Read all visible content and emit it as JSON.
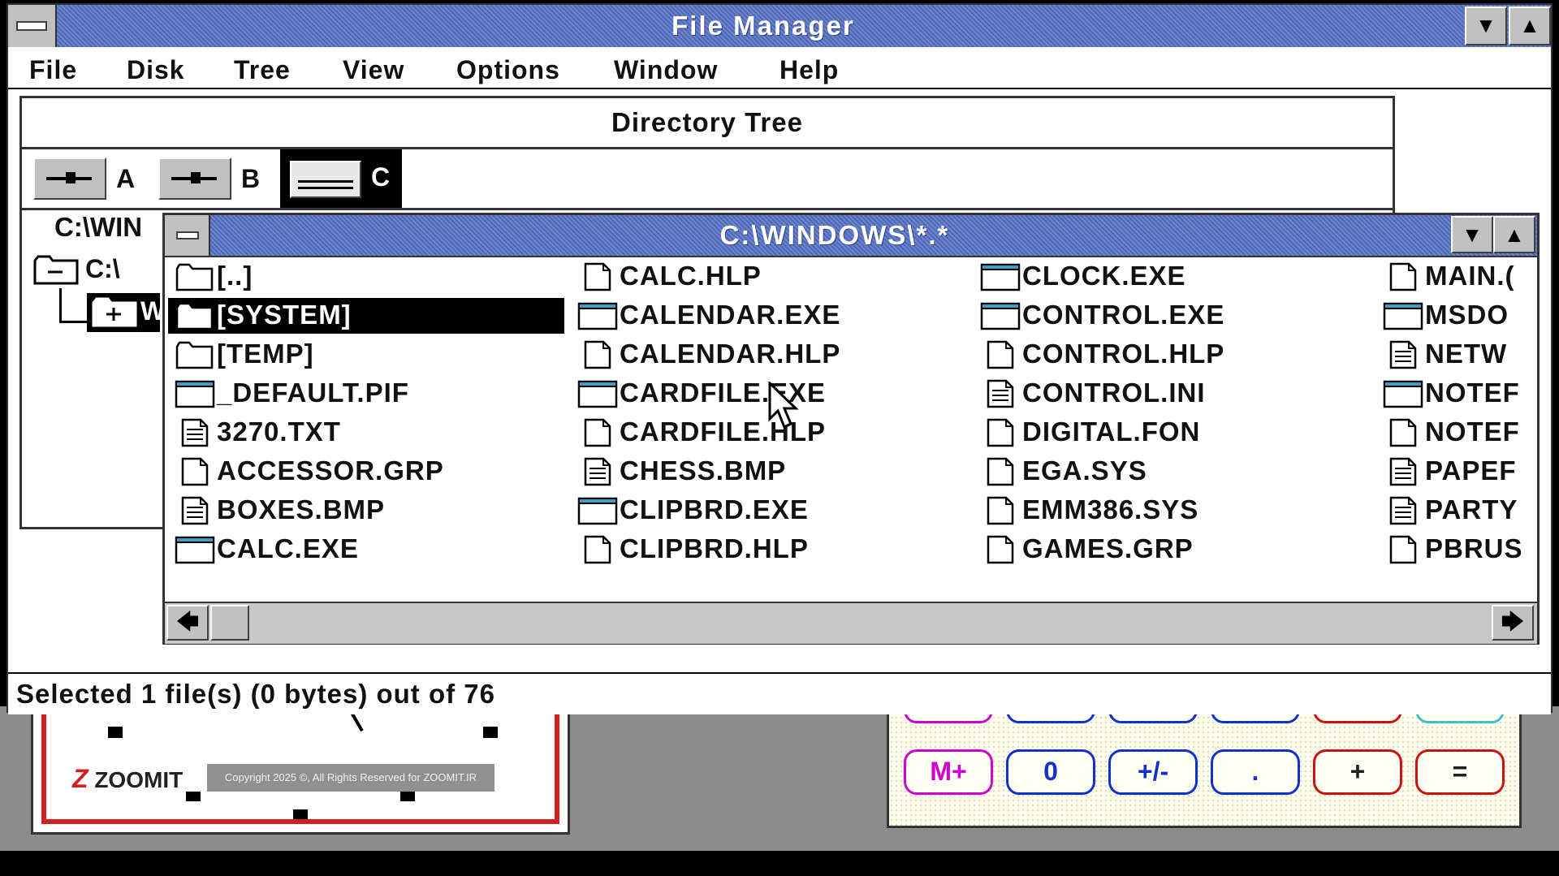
{
  "main_window": {
    "title": "File Manager",
    "menu": [
      "File",
      "Disk",
      "Tree",
      "View",
      "Options",
      "Window",
      "Help"
    ]
  },
  "tree_window": {
    "title": "Directory Tree",
    "drives": [
      "A",
      "B",
      "C"
    ],
    "selected_drive": "C",
    "path": "C:\\WIN",
    "nodes": [
      "C:\\",
      "W"
    ]
  },
  "dir_window": {
    "title": "C:\\WINDOWS\\*.*",
    "columns": [
      [
        {
          "name": "[..]",
          "type": "folder"
        },
        {
          "name": "[SYSTEM]",
          "type": "folder",
          "selected": true
        },
        {
          "name": "[TEMP]",
          "type": "folder"
        },
        {
          "name": "_DEFAULT.PIF",
          "type": "exe"
        },
        {
          "name": "3270.TXT",
          "type": "doc"
        },
        {
          "name": "ACCESSOR.GRP",
          "type": "file"
        },
        {
          "name": "BOXES.BMP",
          "type": "doc"
        },
        {
          "name": "CALC.EXE",
          "type": "exe"
        }
      ],
      [
        {
          "name": "CALC.HLP",
          "type": "file"
        },
        {
          "name": "CALENDAR.EXE",
          "type": "exe"
        },
        {
          "name": "CALENDAR.HLP",
          "type": "file"
        },
        {
          "name": "CARDFILE.EXE",
          "type": "exe"
        },
        {
          "name": "CARDFILE.HLP",
          "type": "file"
        },
        {
          "name": "CHESS.BMP",
          "type": "doc"
        },
        {
          "name": "CLIPBRD.EXE",
          "type": "exe"
        },
        {
          "name": "CLIPBRD.HLP",
          "type": "file"
        }
      ],
      [
        {
          "name": "CLOCK.EXE",
          "type": "exe"
        },
        {
          "name": "CONTROL.EXE",
          "type": "exe"
        },
        {
          "name": "CONTROL.HLP",
          "type": "file"
        },
        {
          "name": "CONTROL.INI",
          "type": "doc"
        },
        {
          "name": "DIGITAL.FON",
          "type": "file"
        },
        {
          "name": "EGA.SYS",
          "type": "file"
        },
        {
          "name": "EMM386.SYS",
          "type": "file"
        },
        {
          "name": "GAMES.GRP",
          "type": "file"
        }
      ],
      [
        {
          "name": "MAIN.(",
          "type": "file"
        },
        {
          "name": "MSDO",
          "type": "exe"
        },
        {
          "name": "NETW",
          "type": "doc"
        },
        {
          "name": "NOTEF",
          "type": "exe"
        },
        {
          "name": "NOTEF",
          "type": "file"
        },
        {
          "name": "PAPEF",
          "type": "doc"
        },
        {
          "name": "PARTY",
          "type": "doc"
        },
        {
          "name": "PBRUS",
          "type": "file"
        }
      ]
    ]
  },
  "status_bar": {
    "text": "Selected 1 file(s) (0 bytes) out of 76"
  },
  "calculator": {
    "buttons": [
      {
        "label": "M+",
        "color": "#d000d0"
      },
      {
        "label": "0",
        "color": "#1030d0"
      },
      {
        "label": "+/-",
        "color": "#1030d0"
      },
      {
        "label": ".",
        "color": "#1030d0"
      },
      {
        "label": "+",
        "color": "#d01010"
      },
      {
        "label": "=",
        "color": "#d01010"
      }
    ]
  },
  "watermark": {
    "brand": "ZOOMIT",
    "copyright": "Copyright 2025 ©, All Rights Reserved for ZOOMIT.IR"
  }
}
